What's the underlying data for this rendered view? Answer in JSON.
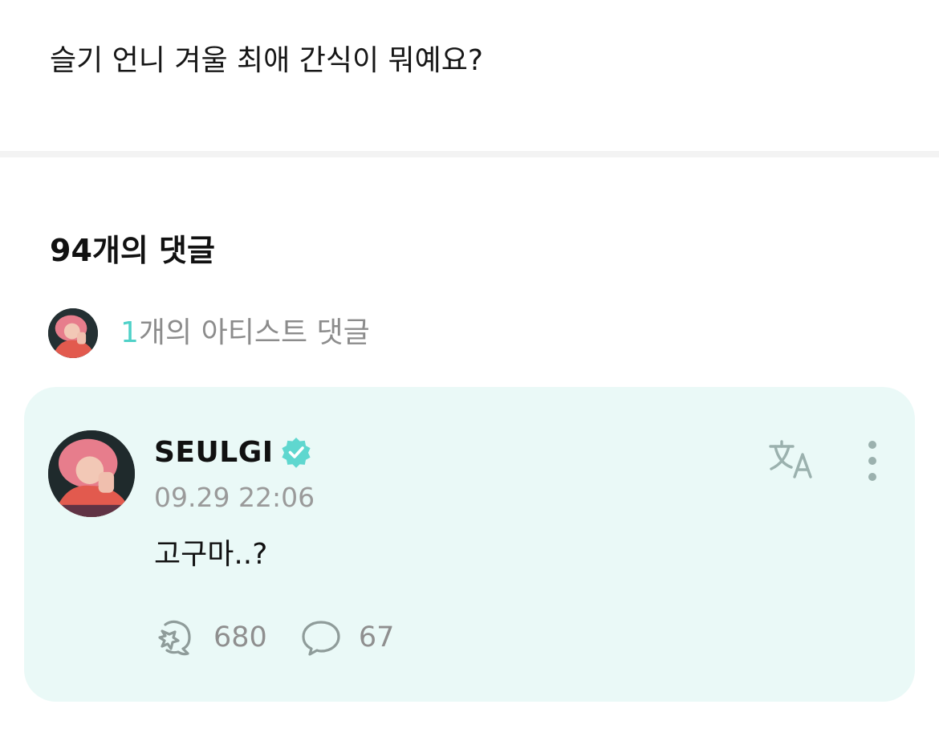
{
  "post": {
    "body": "슬기 언니 겨울 최애 간식이 뭐예요?"
  },
  "comments_section": {
    "title": "94개의 댓글",
    "artist_count_num": "1",
    "artist_count_suffix": "개의 아티스트 댓글"
  },
  "artist_comment": {
    "author": "SEULGI",
    "timestamp": "09.29 22:06",
    "text": "고구마..?",
    "like_count": "680",
    "reply_count": "67"
  },
  "icons": {
    "verified": "verified-badge-icon",
    "translate": "translate-icon",
    "more": "more-vertical-icon",
    "like": "cheer-like-icon",
    "reply": "reply-bubble-icon"
  },
  "colors": {
    "accent": "#4fd1c8",
    "card_background": "#eaf9f7",
    "muted_text": "#8c8c8c"
  }
}
